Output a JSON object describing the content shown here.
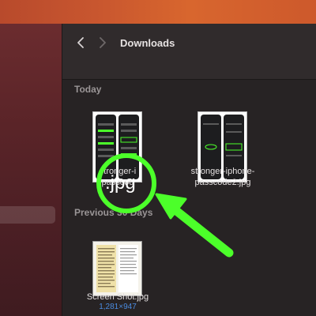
{
  "window": {
    "title": "Downloads"
  },
  "toolbar": {
    "back_icon": "chevron-left-icon",
    "forward_icon": "chevron-right-icon"
  },
  "sections": [
    {
      "header": "Today",
      "files": [
        {
          "name_line1": "stronger-i",
          "name_line2": "passcod",
          "thumbnail": "phone-screenshots-thumbnail"
        },
        {
          "name_line1": "stronger-iphone-",
          "name_line2": "passcode2.jpg",
          "thumbnail": "phone-screenshots-thumbnail"
        }
      ]
    },
    {
      "header": "Previous 30 Days",
      "files": [
        {
          "name_line1": "Screen Shot.jpg",
          "dimensions": "1,281×947",
          "thumbnail": "document-screenshot-thumbnail"
        }
      ]
    }
  ],
  "annotation": {
    "callout_text": ".jpg",
    "color": "#4cff2a"
  },
  "colors": {
    "accent_blue": "#4a8be0",
    "wallpaper": "#c8562f"
  }
}
